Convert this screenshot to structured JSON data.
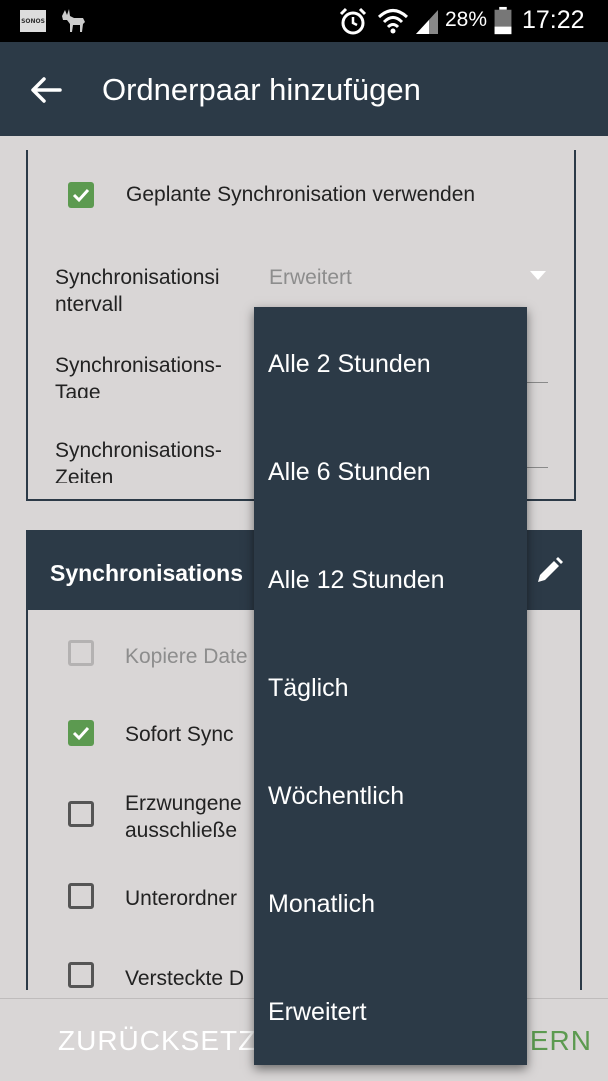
{
  "status_bar": {
    "sonos_label": "SONOS",
    "battery_percent": "28%",
    "time": "17:22",
    "icons": [
      "sonos-icon",
      "deer-icon",
      "alarm-icon",
      "wifi-icon",
      "signal-icon",
      "battery-icon"
    ]
  },
  "app_bar": {
    "title": "Ordnerpaar hinzufügen",
    "back_icon": "back-arrow-icon"
  },
  "schedule": {
    "use_scheduled_label": "Geplante Synchronisation verwenden",
    "use_scheduled_checked": true,
    "interval_label_line1": "Synchronisationsi",
    "interval_label_line2": "ntervall",
    "interval_value": "Erweitert",
    "days_label_line1": "Synchronisations-",
    "days_label_line2": "Tage",
    "times_label_line1": "Synchronisations-",
    "times_label_line2": "Zeiten"
  },
  "sync_options": {
    "title": "Synchronisations",
    "edit_icon": "pencil-icon",
    "items": [
      {
        "line1": "Kopiere Date",
        "line2": "",
        "state": "disabled"
      },
      {
        "line1": "Sofort Sync",
        "line2": "",
        "state": "checked"
      },
      {
        "line1": "Erzwungene",
        "line2": "ausschließe",
        "state": "unchecked"
      },
      {
        "line1": "Unterordner",
        "line2": "",
        "state": "unchecked"
      },
      {
        "line1": "Versteckte D",
        "line2": "",
        "state": "unchecked"
      }
    ]
  },
  "bottom_bar": {
    "reset_label": "ZURÜCKSETZ",
    "save_label": "HERN"
  },
  "interval_dropdown": {
    "options": [
      "Alle 2 Stunden",
      "Alle 6 Stunden",
      "Alle 12 Stunden",
      "Täglich",
      "Wöchentlich",
      "Monatlich",
      "Erweitert"
    ],
    "selected": "Erweitert"
  },
  "colors": {
    "primary": "#2c3a47",
    "accent_green": "#5c9a50",
    "background": "#d9d6d6"
  }
}
